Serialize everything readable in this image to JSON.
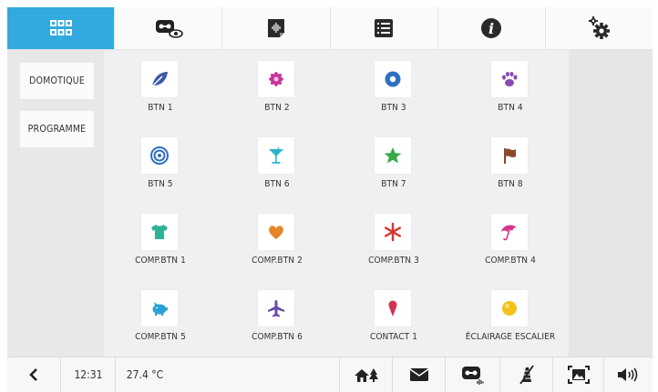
{
  "top_tabs": [
    {
      "icon": "grid-icon",
      "active": true
    },
    {
      "icon": "voicemail-eye-icon",
      "active": false
    },
    {
      "icon": "audio-file-icon",
      "active": false
    },
    {
      "icon": "list-icon",
      "active": false
    },
    {
      "icon": "info-icon",
      "active": false
    },
    {
      "icon": "settings-gears-icon",
      "active": false
    }
  ],
  "sidebar": {
    "items": [
      {
        "label": "DOMOTIQUE"
      },
      {
        "label": "PROGRAMME"
      }
    ]
  },
  "grid": {
    "buttons": [
      {
        "label": "BTN 1",
        "icon": "leaf-icon",
        "color": "#3d5aa8"
      },
      {
        "label": "BTN 2",
        "icon": "flower-icon",
        "color": "#c8359a"
      },
      {
        "label": "BTN 3",
        "icon": "donut-icon",
        "color": "#2f6fc0"
      },
      {
        "label": "BTN 4",
        "icon": "paw-icon",
        "color": "#8a4bb0"
      },
      {
        "label": "BTN 5",
        "icon": "target-icon",
        "color": "#2f6fc0"
      },
      {
        "label": "BTN 6",
        "icon": "cocktail-icon",
        "color": "#28b4cf"
      },
      {
        "label": "BTN 7",
        "icon": "star-icon",
        "color": "#35a84a"
      },
      {
        "label": "BTN 8",
        "icon": "flag-icon",
        "color": "#8a4a2a"
      },
      {
        "label": "COMP.BTN 1",
        "icon": "tshirt-icon",
        "color": "#2fb199"
      },
      {
        "label": "COMP.BTN 2",
        "icon": "heart-icon",
        "color": "#e5862a"
      },
      {
        "label": "COMP.BTN 3",
        "icon": "asterisk-icon",
        "color": "#d8322f"
      },
      {
        "label": "COMP.BTN 4",
        "icon": "umbrella-icon",
        "color": "#d6368a"
      },
      {
        "label": "COMP.BTN 5",
        "icon": "piggy-bank-icon",
        "color": "#2aa0d8"
      },
      {
        "label": "COMP.BTN 6",
        "icon": "airplane-icon",
        "color": "#6a4aa8"
      },
      {
        "label": "CONTACT 1",
        "icon": "ice-cream-icon",
        "color": "#d23350"
      },
      {
        "label": "ÉCLAIRAGE ESCALIER",
        "icon": "ball-icon",
        "color": "#f3c21a"
      }
    ]
  },
  "bottom_bar": {
    "time": "12:31",
    "temperature": "27.4 °C",
    "icons": [
      "back-chevron-icon",
      "home-trees-icon",
      "mail-icon",
      "voicemail-icon",
      "mute-mic-icon",
      "picture-frame-icon",
      "volume-icon"
    ]
  }
}
